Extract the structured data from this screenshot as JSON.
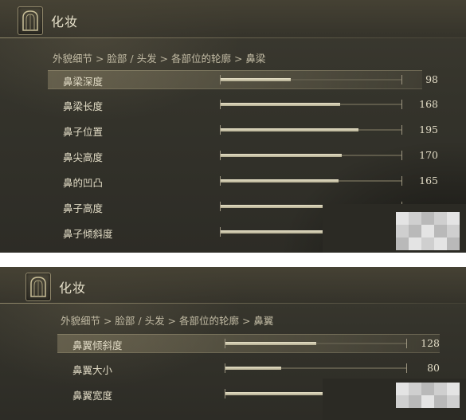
{
  "panels": [
    {
      "title": "化妆",
      "breadcrumb": "外貌细节 > 脸部 / 头发 > 各部位的轮廓 > 鼻梁",
      "rows": [
        {
          "label": "鼻梁深度",
          "value": "98",
          "level": 0.39,
          "selected": true
        },
        {
          "label": "鼻梁长度",
          "value": "168",
          "level": 0.66,
          "selected": false
        },
        {
          "label": "鼻子位置",
          "value": "195",
          "level": 0.76,
          "selected": false
        },
        {
          "label": "鼻尖高度",
          "value": "170",
          "level": 0.67,
          "selected": false
        },
        {
          "label": "鼻的凹凸",
          "value": "165",
          "level": 0.65,
          "selected": false
        },
        {
          "label": "鼻子高度",
          "value": "",
          "level": 0.57,
          "selected": false
        },
        {
          "label": "鼻子倾斜度",
          "value": "",
          "level": 0.57,
          "selected": false
        }
      ]
    },
    {
      "title": "化妆",
      "breadcrumb": "外貌细节 > 脸部 / 头发 > 各部位的轮廓 > 鼻翼",
      "rows": [
        {
          "label": "鼻翼倾斜度",
          "value": "128",
          "level": 0.5,
          "selected": true
        },
        {
          "label": "鼻翼大小",
          "value": "80",
          "level": 0.31,
          "selected": false
        },
        {
          "label": "鼻翼宽度",
          "value": "",
          "level": 0.54,
          "selected": false
        }
      ]
    }
  ],
  "icons": {
    "emblem": "arched-doorway-icon"
  },
  "colors": {
    "background": "#34332b",
    "text": "#e0dac4",
    "slider_fill": "#e8e2c8",
    "selected_row": "#8c8468"
  }
}
